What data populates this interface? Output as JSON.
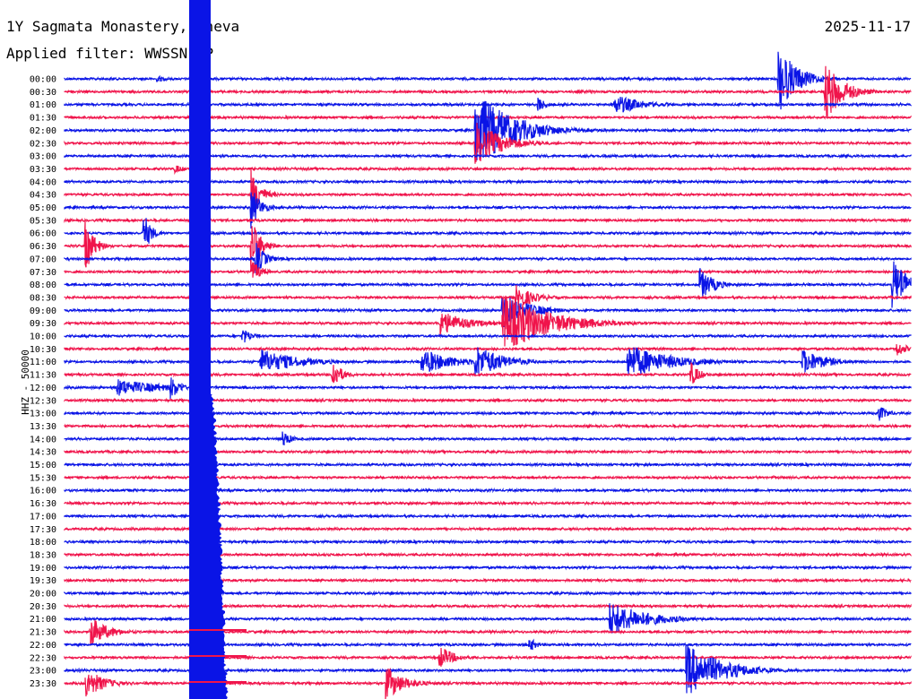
{
  "header": {
    "station": "1Y Sagmata Monastery, Theva",
    "date": "2025-11-17",
    "filter": "Applied filter: WWSSN-SP"
  },
  "channel_label": "HHZ - 50000",
  "colors": {
    "blue": "#0a14e6",
    "red": "#f0144b",
    "background": "#ffffff"
  },
  "trace_times": [
    "00:00",
    "00:30",
    "01:00",
    "01:30",
    "02:00",
    "02:30",
    "03:00",
    "03:30",
    "04:00",
    "04:30",
    "05:00",
    "05:30",
    "06:00",
    "06:30",
    "07:00",
    "07:30",
    "08:00",
    "08:30",
    "09:00",
    "09:30",
    "10:00",
    "10:30",
    "11:00",
    "11:30",
    "12:00",
    "12:30",
    "13:00",
    "13:30",
    "14:00",
    "14:30",
    "15:00",
    "15:30",
    "16:00",
    "16:30",
    "17:00",
    "17:30",
    "18:00",
    "18:30",
    "19:00",
    "19:30",
    "20:00",
    "20:30",
    "21:00",
    "21:30",
    "22:00",
    "22:30",
    "23:00",
    "23:30"
  ]
}
